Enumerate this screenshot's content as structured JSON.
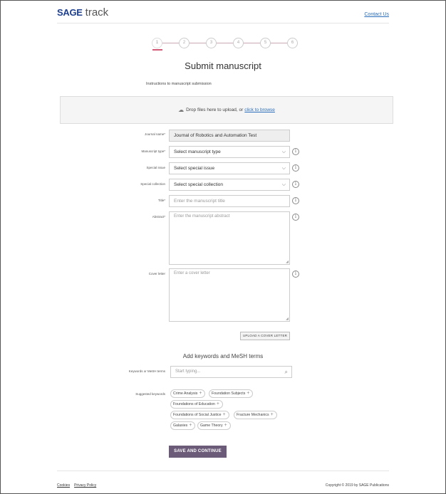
{
  "header": {
    "logo_brand": "SAGE",
    "logo_product": "track",
    "contact_link": "Contact Us"
  },
  "stepper": {
    "steps": [
      "1",
      "2",
      "3",
      "4",
      "5",
      "6"
    ],
    "current_step": 1,
    "accent_color": "#d25b78"
  },
  "page": {
    "title": "Submit manuscript",
    "instructions": "Instructions to manuscript submission"
  },
  "dropzone": {
    "text": "Drop files here to upload, or",
    "link": "click to browse",
    "icon": "cloud-upload-icon"
  },
  "form": {
    "journal": {
      "label": "Journal name*",
      "value": "Journal of Robotics and Automation Test"
    },
    "manuscript_type": {
      "label": "Manuscript type*",
      "value": "Select manuscript type"
    },
    "special_issue": {
      "label": "Special issue",
      "value": "Select special issue"
    },
    "special_collection": {
      "label": "Special collection",
      "value": "Select special collection"
    },
    "title": {
      "label": "Title*",
      "placeholder": "Enter the manuscript title"
    },
    "abstract": {
      "label": "Abstract*",
      "placeholder": "Enter the manuscript abstract"
    },
    "cover_letter": {
      "label": "Cover letter",
      "placeholder": "Enter a cover letter"
    },
    "upload_cover_button": "UPLOAD A COVER LETTER"
  },
  "keywords": {
    "section_title": "Add keywords and MeSH terms",
    "input_label": "Keywords or MeSH terms",
    "input_placeholder": "Start typing...",
    "suggested_label": "Suggested keywords",
    "suggested": [
      "Crime Analysis",
      "Foundation Subjects",
      "Foundations of Education",
      "Foundations of Social Justice",
      "Fracture Mechanics",
      "Galaxies",
      "Game Theory"
    ]
  },
  "actions": {
    "save_continue": "SAVE AND CONTINUE",
    "primary_color": "#6b5b79"
  },
  "footer": {
    "cookies": "Cookies",
    "privacy": "Privacy Policy",
    "copyright": "Copyright © 2019 by SAGE Publications"
  }
}
